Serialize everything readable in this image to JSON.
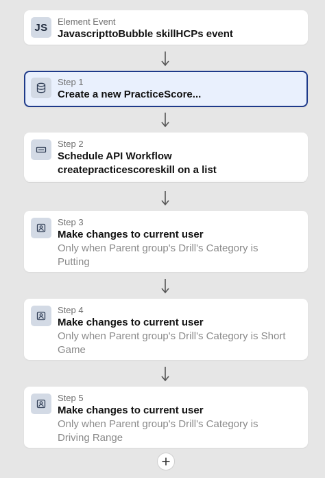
{
  "event": {
    "icon_text": "JS",
    "type_label": "Element Event",
    "title": "JavascripttoBubble skillHCPs event"
  },
  "steps": [
    {
      "icon": "database-icon",
      "step_label": "Step 1",
      "title": "Create a new PracticeScore...",
      "selected": true
    },
    {
      "icon": "api-workflow-icon",
      "step_label": "Step 2",
      "title_line1": "Schedule API Workflow",
      "title_line2": "createpracticescoreskill on a list"
    },
    {
      "icon": "user-card-icon",
      "step_label": "Step 3",
      "title": "Make changes to current user",
      "condition_line1": "Only when Parent group's Drill's Category is",
      "condition_line2": "Putting"
    },
    {
      "icon": "user-card-icon",
      "step_label": "Step 4",
      "title": "Make changes to current user",
      "condition_line1": "Only when Parent group's Drill's Category is Short",
      "condition_line2": "Game"
    },
    {
      "icon": "user-card-icon",
      "step_label": "Step 5",
      "title": "Make changes to current user",
      "condition_line1": "Only when Parent group's Drill's Category is",
      "condition_line2": "Driving Range"
    }
  ],
  "add_button": {
    "symbol": "+"
  },
  "colors": {
    "background": "#e6e6e6",
    "card": "#ffffff",
    "selected_fill": "#e9f0fd",
    "selected_border": "#1e3a8a",
    "icon_box": "#d3dae5"
  }
}
